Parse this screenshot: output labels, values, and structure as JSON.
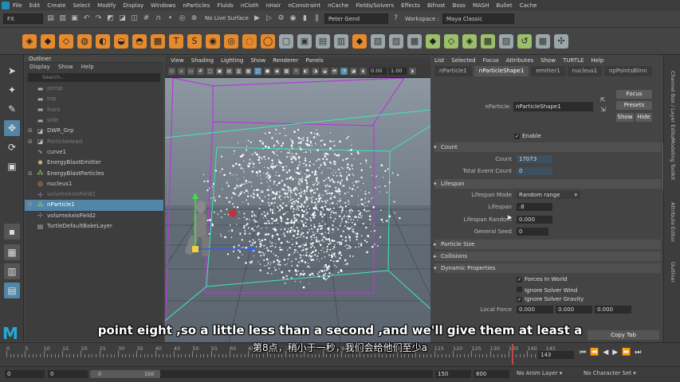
{
  "menubar": {
    "items": [
      "File",
      "Edit",
      "Create",
      "Select",
      "Modify",
      "Display",
      "Windows",
      "nParticles",
      "Fluids",
      "nCloth",
      "nHair",
      "nConstraint",
      "nCache",
      "Fields/Solvers",
      "Effects",
      "Bifrost",
      "Boss",
      "MASH",
      "Bullet",
      "Cache"
    ],
    "workspace_label": "Workspace :",
    "workspace_value": "Maya Classic"
  },
  "statusline": {
    "mode": "FX",
    "live_surface": "No Live Surface",
    "user": "Peter Gend"
  },
  "outliner": {
    "title": "Outliner",
    "menus": [
      "Display",
      "Show",
      "Help"
    ],
    "search_placeholder": "Search...",
    "rows": [
      {
        "label": "persp",
        "icon": "camera-icon",
        "dim": true,
        "exp": ""
      },
      {
        "label": "top",
        "icon": "camera-icon",
        "dim": true,
        "exp": ""
      },
      {
        "label": "front",
        "icon": "camera-icon",
        "dim": true,
        "exp": ""
      },
      {
        "label": "side",
        "icon": "camera-icon",
        "dim": true,
        "exp": ""
      },
      {
        "label": "DWR_Grp",
        "icon": "group-icon",
        "dim": false,
        "exp": "⊞"
      },
      {
        "label": "ParticleHead",
        "icon": "group-icon",
        "dim": true,
        "exp": "⊞"
      },
      {
        "label": "curve1",
        "icon": "curve-icon",
        "dim": false,
        "exp": ""
      },
      {
        "label": "EnergyBlastEmitter",
        "icon": "emitter-icon",
        "dim": false,
        "exp": ""
      },
      {
        "label": "EnergyBlastParticles",
        "icon": "particle-icon",
        "dim": false,
        "exp": "⊞"
      },
      {
        "label": "nucleus1",
        "icon": "nucleus-icon",
        "dim": false,
        "exp": ""
      },
      {
        "label": "volumeAxisField1",
        "icon": "field-icon",
        "dim": true,
        "exp": ""
      },
      {
        "label": "nParticle1",
        "icon": "particle-icon",
        "dim": false,
        "exp": "⊞",
        "selected": true
      },
      {
        "label": "volumeAxisField2",
        "icon": "field-icon",
        "dim": false,
        "exp": ""
      },
      {
        "label": "TurtleDefaultBakeLayer",
        "icon": "layer-icon",
        "dim": false,
        "exp": ""
      }
    ]
  },
  "viewport": {
    "menus": [
      "View",
      "Shading",
      "Lighting",
      "Show",
      "Renderer",
      "Panels"
    ],
    "field1": "0.00",
    "field2": "1.00"
  },
  "attribute_editor": {
    "menus": [
      "List",
      "Selected",
      "Focus",
      "Attributes",
      "Show",
      "TURTLE",
      "Help"
    ],
    "tabs": [
      {
        "label": "nParticle1"
      },
      {
        "label": "nParticleShape1"
      },
      {
        "label": "emitter1"
      },
      {
        "label": "nucleus1"
      },
      {
        "label": "npPointsBlinn"
      }
    ],
    "nparticle_label": "nParticle:",
    "nparticle_value": "nParticleShape1",
    "focus": "Focus",
    "presets": "Presets",
    "show": "Show",
    "hide": "Hide",
    "enable": "Enable",
    "sections": {
      "count": "Count",
      "lifespan": "Lifespan",
      "particle_size": "Particle Size",
      "collisions": "Collisions",
      "dynamic_properties": "Dynamic Properties"
    },
    "count_label": "Count",
    "count_value": "17073",
    "total_event_label": "Total Event Count",
    "total_event_value": "0",
    "lifespan_mode_label": "Lifespan Mode",
    "lifespan_mode_value": "Random range",
    "lifespan_label": "Lifespan",
    "lifespan_value": ".8",
    "lifespan_random_label": "Lifespan Random",
    "lifespan_random_value": "0.000",
    "general_seed_label": "General Seed",
    "general_seed_value": "0",
    "forces_in_world": "Forces In World",
    "ignore_solver_wind": "Ignore Solver Wind",
    "ignore_solver_gravity": "Ignore Solver Gravity",
    "local_force_label": "Local Force",
    "local_force": [
      "0.000",
      "0.000",
      "0.000"
    ],
    "copy_tab": "Copy Tab"
  },
  "right_tabs": [
    "Channel Box / Layer Editor",
    "Modeling Toolkit",
    "Attribute Editor",
    "Outliner"
  ],
  "timeline": {
    "ticks": [
      "0",
      "5",
      "10",
      "15",
      "20",
      "25",
      "30",
      "35",
      "40",
      "45",
      "50",
      "55",
      "60",
      "65",
      "70",
      "75",
      "80",
      "85",
      "90",
      "95",
      "100",
      "105",
      "110",
      "115",
      "120",
      "125",
      "130",
      "135",
      "140",
      "145"
    ],
    "current_frame": "143",
    "current_marker": "143"
  },
  "range": {
    "start": "0",
    "start2": "0",
    "inner_start": "0",
    "inner_end": "150",
    "end1": "150",
    "end2": "800",
    "anim_layer": "No Anim Layer",
    "char_set": "No Character Set"
  },
  "subtitles": {
    "en": "point eight ,so a little less than a second ,and we'll give them at least a",
    "zh": "第8点，稍小于一秒，我们会给他们至少a"
  }
}
